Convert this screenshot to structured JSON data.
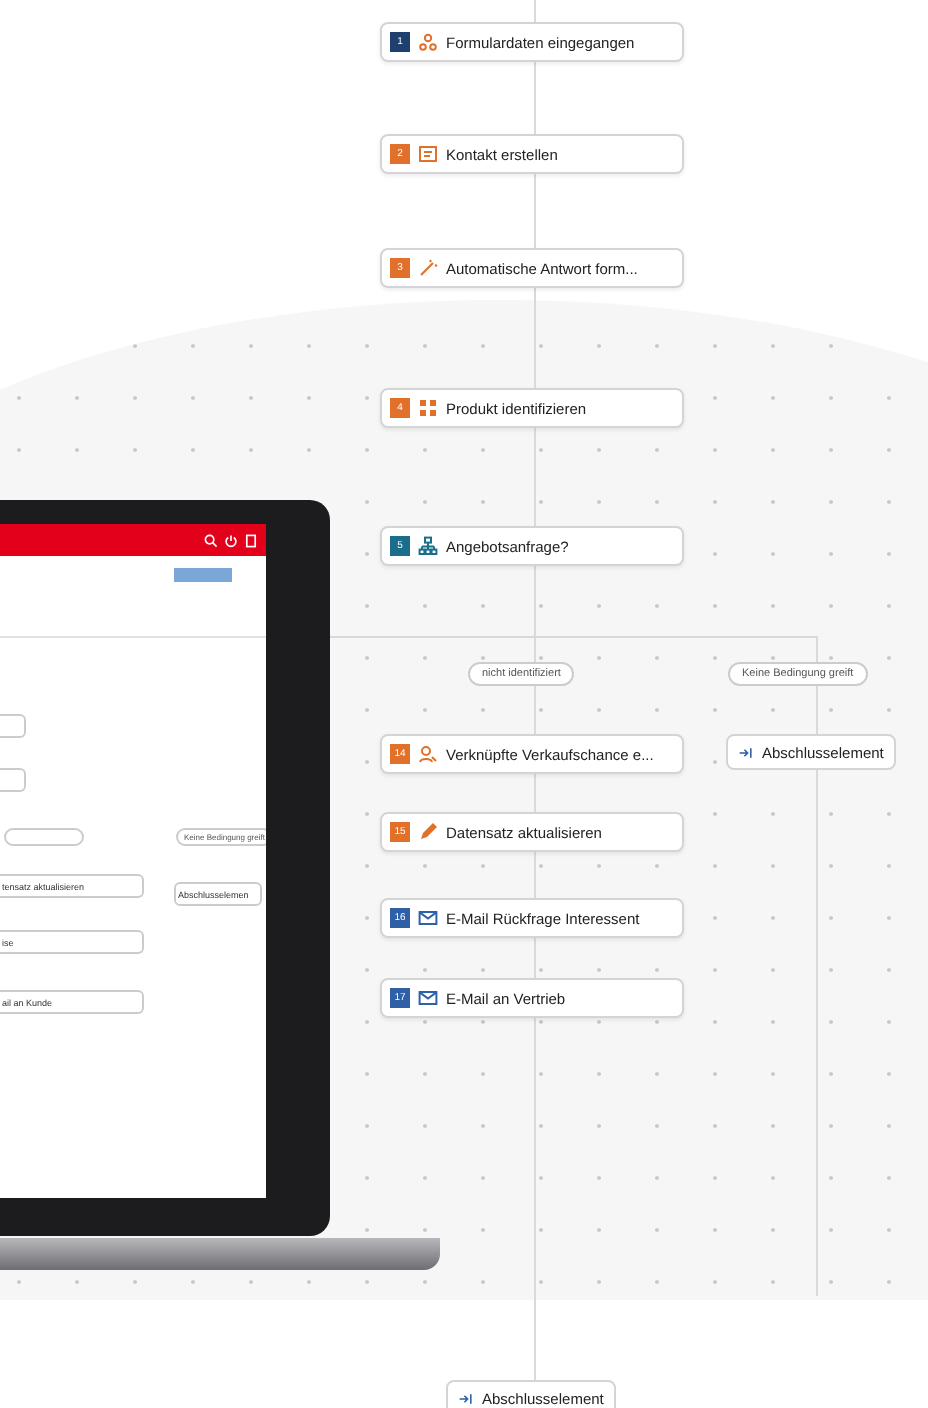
{
  "steps": [
    {
      "number": "1",
      "kind": "trigger",
      "color": "#1f3f6e",
      "label": "Formulardaten eingegangen"
    },
    {
      "number": "2",
      "kind": "create",
      "color": "#e0702a",
      "label": "Kontakt erstellen"
    },
    {
      "number": "3",
      "kind": "ai",
      "color": "#e0702a",
      "label": "Automatische Antwort form..."
    },
    {
      "number": "4",
      "kind": "identify",
      "color": "#e0702a",
      "label": "Produkt identifizieren"
    },
    {
      "number": "5",
      "kind": "condition",
      "color": "#1a6e8c",
      "label": "Angebotsanfrage?"
    },
    {
      "number": "14",
      "kind": "link",
      "color": "#e0702a",
      "label": "Verknüpfte Verkaufschance e..."
    },
    {
      "number": "15",
      "kind": "update",
      "color": "#e0702a",
      "label": "Datensatz aktualisieren"
    },
    {
      "number": "16",
      "kind": "email",
      "color": "#2f5fa7",
      "label": "E-Mail Rückfrage Interessent"
    },
    {
      "number": "17",
      "kind": "email",
      "color": "#2f5fa7",
      "label": "E-Mail an Vertrieb"
    }
  ],
  "branches": [
    "nicht identifiziert",
    "Keine Bedingung greift"
  ],
  "end_nodes": [
    "Abschlusselement",
    "Abschlusselement"
  ],
  "laptop_screen": {
    "branch_label": "Keine Bedingung greift",
    "steps": [
      "tensatz aktualisieren",
      "ise",
      "ail an Kunde"
    ],
    "end_node": "Abschlusselemen"
  }
}
